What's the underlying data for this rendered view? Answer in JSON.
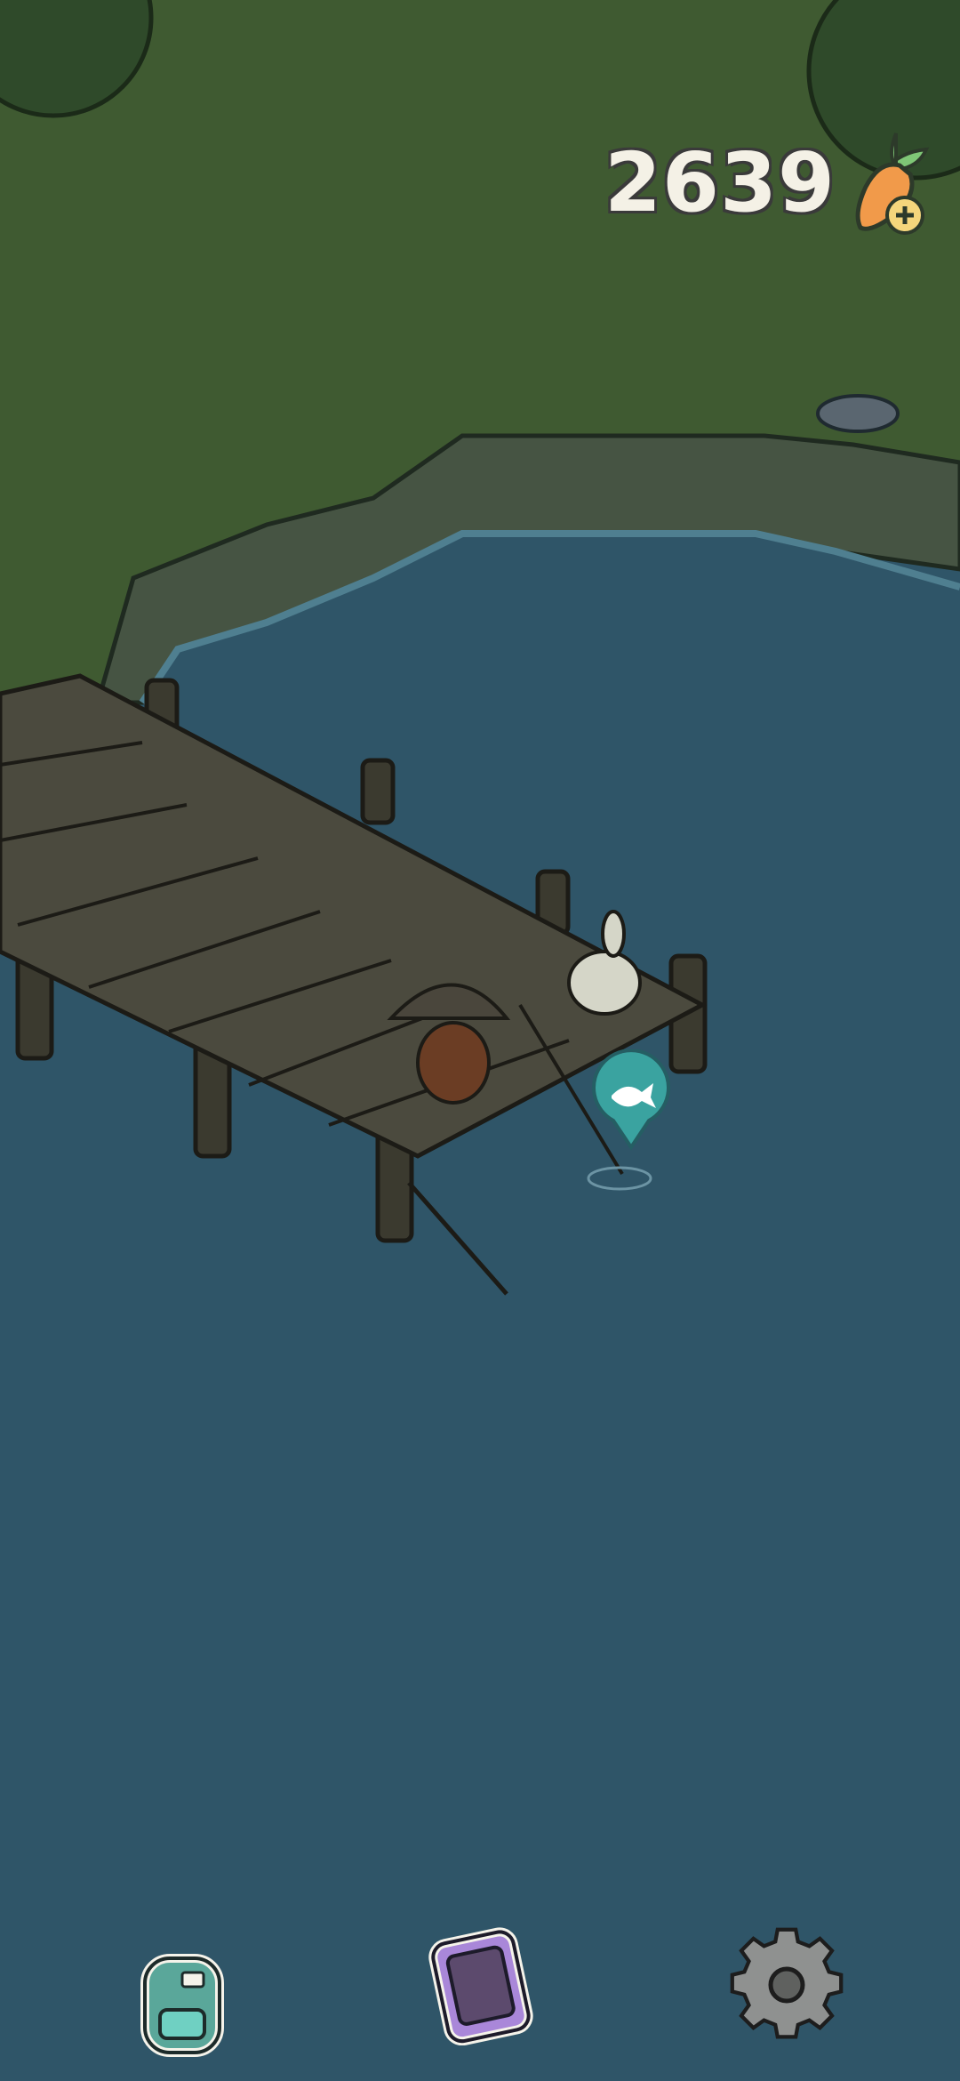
{
  "hud": {
    "carrot_count": "2639",
    "carrot_icon": "carrot-plus-icon"
  },
  "bottom_bar": {
    "items": [
      {
        "icon": "backpack-icon"
      },
      {
        "icon": "phone-icon"
      },
      {
        "icon": "gear-icon"
      }
    ]
  },
  "scene": {
    "fish_marker_icon": "fish-marker-icon",
    "colors": {
      "grass": "#3f5a31",
      "water": "#2f5568",
      "dock": "#4a4a3e",
      "marker": "#3aa3a0"
    }
  }
}
